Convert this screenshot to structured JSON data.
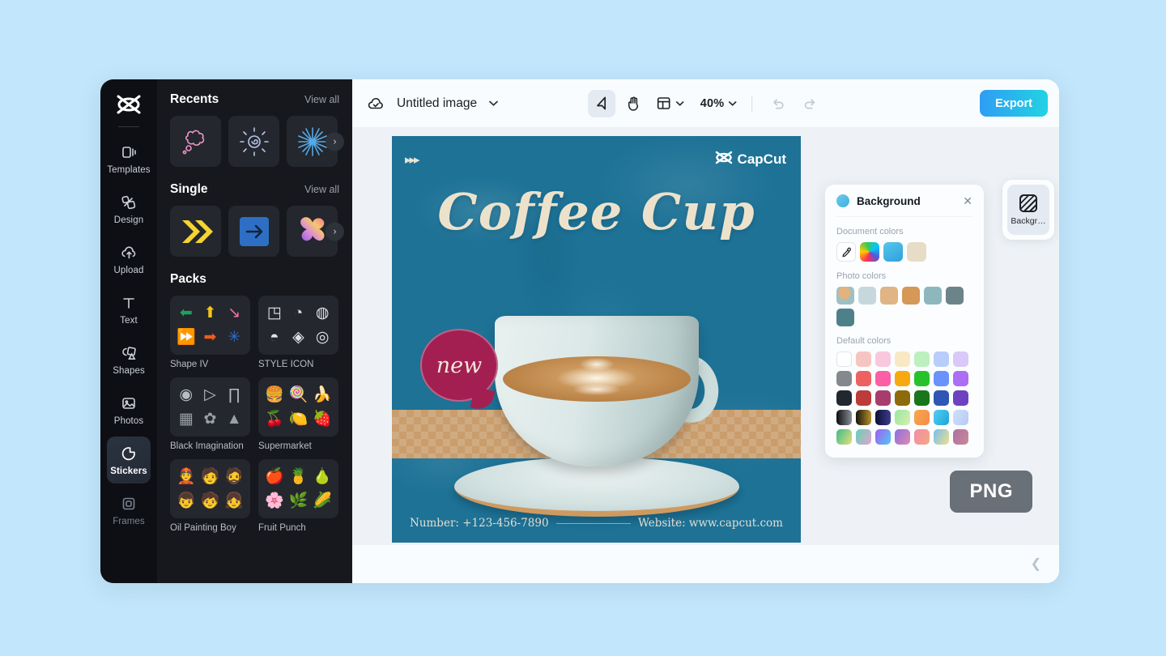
{
  "app": {
    "background_color": "#c2e6fb",
    "logo_icon": "capcut-logo-icon"
  },
  "rail": {
    "items": [
      {
        "label": "Templates",
        "icon": "templates-icon",
        "active": false
      },
      {
        "label": "Design",
        "icon": "design-icon",
        "active": false
      },
      {
        "label": "Upload",
        "icon": "upload-cloud-icon",
        "active": false
      },
      {
        "label": "Text",
        "icon": "text-icon",
        "active": false
      },
      {
        "label": "Shapes",
        "icon": "shapes-icon",
        "active": false
      },
      {
        "label": "Photos",
        "icon": "photos-icon",
        "active": false
      },
      {
        "label": "Stickers",
        "icon": "stickers-icon",
        "active": true
      },
      {
        "label": "Frames",
        "icon": "frames-icon",
        "active": false
      }
    ]
  },
  "panel": {
    "sections": [
      {
        "title": "Recents",
        "view_all": "View all",
        "thumbs": [
          "cloud-doodle-sticker",
          "sun-swirl-sticker",
          "starburst-sticker"
        ],
        "has_next_arrow": true
      },
      {
        "title": "Single",
        "view_all": "View all",
        "thumbs": [
          "yellow-double-chevron-sticker",
          "blue-arrow-square-sticker",
          "gradient-blob-sticker"
        ],
        "has_next_arrow": true
      }
    ],
    "packs_title": "Packs",
    "packs": [
      {
        "name": "Shape IV",
        "cells": [
          "⬅",
          "⬆",
          "↘",
          "⏩",
          "➡",
          "✳"
        ]
      },
      {
        "name": "STYLE ICON",
        "cells": [
          "◳",
          "◔",
          "◍",
          "◓",
          "◈",
          "◎"
        ]
      },
      {
        "name": "Black Imagination",
        "cells": [
          "◉",
          "▷",
          "∏",
          "▦",
          "✿",
          "▲"
        ]
      },
      {
        "name": "Supermarket",
        "cells": [
          "🍔",
          "🍭",
          "🍌",
          "🍒",
          "🍋",
          "🍓"
        ]
      },
      {
        "name": "Oil Painting Boy",
        "cells": [
          "👲",
          "🧑",
          "🧔",
          "👦",
          "🧒",
          "👧"
        ]
      },
      {
        "name": "Fruit Punch",
        "cells": [
          "🍎",
          "🍍",
          "🍐",
          "🌸",
          "🌿",
          "🌽"
        ]
      }
    ]
  },
  "topbar": {
    "cloud_icon": "cloud-saved-icon",
    "doc_title": "Untitled image",
    "doc_caret_icon": "chevron-down-icon",
    "tools": [
      {
        "name": "select-tool",
        "icon": "cursor-arrow-icon",
        "selected": true
      },
      {
        "name": "hand-tool",
        "icon": "hand-icon",
        "selected": false
      },
      {
        "name": "layout-tool",
        "icon": "layout-grid-icon",
        "selected": false
      }
    ],
    "layout_caret_icon": "chevron-down-icon",
    "zoom_value": "40%",
    "zoom_caret_icon": "chevron-down-icon",
    "undo_icon": "undo-icon",
    "redo_icon": "redo-icon",
    "export_label": "Export",
    "export_color": "#2f9cf4"
  },
  "poster": {
    "arrows": "▸▸▸",
    "brand": "CapCut",
    "brand_icon": "capcut-logo-icon",
    "title": "Coffee Cup",
    "badge": "new",
    "badge_color": "#a31f52",
    "background_color": "#1d7296",
    "phone_label": "Number: +123-456-7890",
    "website_label": "Website: www.capcut.com"
  },
  "background_panel": {
    "title": "Background",
    "close_icon": "close-icon",
    "sections": [
      {
        "label": "Document colors",
        "swatches": [
          {
            "name": "eyedropper",
            "icon": "eyedropper-icon",
            "color": "#ffffff"
          },
          {
            "name": "rainbow",
            "color": "conic"
          },
          {
            "name": "sky",
            "color": "#3fb3e0"
          },
          {
            "name": "sand",
            "color": "#e7dcc6"
          }
        ]
      },
      {
        "label": "Photo colors",
        "swatches": [
          {
            "name": "image-thumb",
            "color": "#b08860"
          },
          {
            "name": "pale-blue",
            "color": "#c6d8dc"
          },
          {
            "name": "tan",
            "color": "#e0b484"
          },
          {
            "name": "ochre",
            "color": "#d59857"
          },
          {
            "name": "teal-light",
            "color": "#8db7bd"
          },
          {
            "name": "slate",
            "color": "#6c8389"
          },
          {
            "name": "teal-dark",
            "color": "#4e8089"
          }
        ]
      },
      {
        "label": "Default colors",
        "rows": [
          [
            "#fbfdff",
            "#f7c5c1",
            "#f9c8dd",
            "#f8e9c4",
            "#bdf0be",
            "#b9cdfb",
            "#dac9f8"
          ],
          [
            "#85898e",
            "#ed6260",
            "#fb5fa4",
            "#f7a90f",
            "#27c22b",
            "#6a92fb",
            "#ad6ef6"
          ],
          [
            "#22262f",
            "#bd3b39",
            "#a83c6d",
            "#8d6b0b",
            "#19761a",
            "#2f56b5",
            "#6e41c0"
          ],
          [
            "grad-dark",
            "grad-gold",
            "grad-navy",
            "grad-mint",
            "grad-orange",
            "grad-cyan",
            "grad-periwinkle"
          ],
          [
            "grad-greenyellow",
            "grad-tealpink",
            "grad-purpleblue",
            "grad-violetpink",
            "grad-pinkorange",
            "grad-blueyellow",
            "grad-mauve"
          ]
        ]
      }
    ]
  },
  "dock": {
    "button_label": "Backgr…",
    "button_icon": "background-pattern-icon"
  },
  "overlay": {
    "png_tag": "PNG",
    "collapse_icon": "chevron-left-icon"
  }
}
